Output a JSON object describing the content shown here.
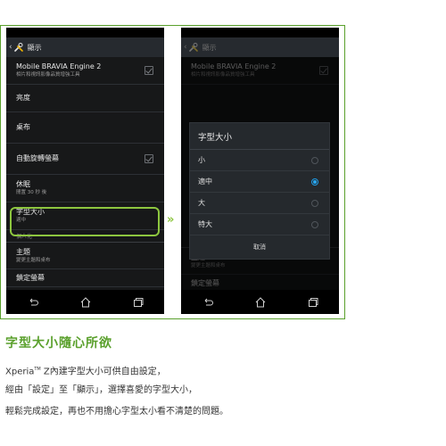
{
  "left_screen": {
    "header_title": "顯示",
    "items": [
      {
        "title": "Mobile BRAVIA Engine 2",
        "subtitle": "相片和視訊影像品質增強工具",
        "checkbox": true
      },
      {
        "title": "亮度",
        "subtitle": "",
        "checkbox": false
      },
      {
        "title": "桌布",
        "subtitle": "",
        "checkbox": false
      },
      {
        "title": "自動旋轉螢幕",
        "subtitle": "",
        "checkbox": true
      },
      {
        "title": "休眠",
        "subtitle": "閒置 30 秒 後",
        "checkbox": false
      },
      {
        "title": "字型大小",
        "subtitle": "適中",
        "checkbox": false
      }
    ],
    "section_header": "個人化",
    "items_after": [
      {
        "title": "主題",
        "subtitle": "變更主題和桌布"
      },
      {
        "title": "鎖定螢幕",
        "subtitle": ""
      }
    ]
  },
  "right_screen": {
    "header_title": "顯示",
    "dialog": {
      "title": "字型大小",
      "options": [
        "小",
        "適中",
        "大",
        "特大"
      ],
      "selected_index": 1,
      "cancel_label": "取消"
    }
  },
  "arrow_symbol": "»",
  "caption": {
    "title": "字型大小隨心所欲",
    "line1_prefix": "Xperia",
    "line1_tm": "TM",
    "line1_rest": " Z內建字型大小可供自由設定，",
    "line2": "經由「設定」至「顯示」，選擇喜愛的字型大小，",
    "line3": "輕鬆完成設定，再也不用擔心字型太小看不清楚的問題。"
  },
  "colors": {
    "accent_green": "#8dc63f",
    "title_green": "#5aa02c",
    "radio_blue": "#2aa7f0"
  }
}
